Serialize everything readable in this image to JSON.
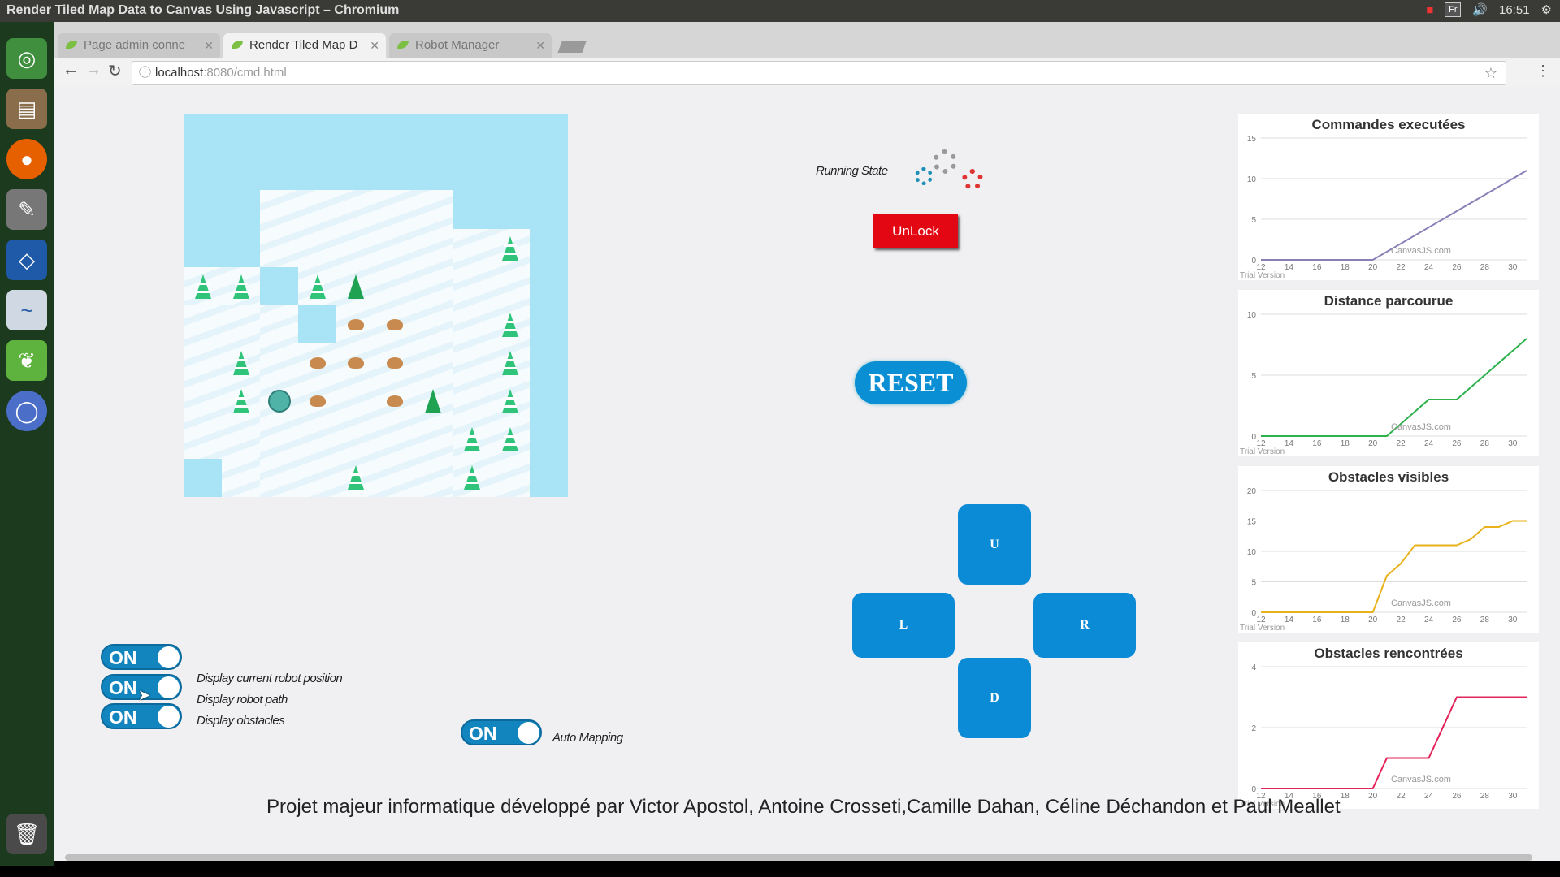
{
  "window": {
    "title": "Render Tiled Map Data to Canvas Using Javascript – Chromium"
  },
  "system_tray": {
    "lang": "Fr",
    "time": "16:51"
  },
  "tabs": [
    {
      "label": "Page admin conne",
      "active": false
    },
    {
      "label": "Render Tiled Map D",
      "active": true
    },
    {
      "label": "Robot Manager",
      "active": false
    }
  ],
  "address_bar": {
    "host": "localhost",
    "rest": ":8080/cmd.html"
  },
  "status": {
    "running_state_label": "Running State"
  },
  "buttons": {
    "unlock": "UnLock",
    "reset": "RESET",
    "up": "U",
    "left": "L",
    "right": "R",
    "down": "D"
  },
  "toggles": [
    {
      "state": "ON",
      "label": ""
    },
    {
      "state": "ON",
      "label": "Display current robot position"
    },
    {
      "state": "ON",
      "label": "Display robot path"
    },
    {
      "state": "ON",
      "label": "Display obstacles"
    },
    {
      "state": "ON",
      "label": "Auto Mapping"
    }
  ],
  "footer_text": "Projet majeur informatique développé par Victor Apostol, Antoine Crosseti,Camille Dahan, Céline Déchandon et Paul Meallet",
  "watermark": "CanvasJS.com",
  "trial": "Trial Version",
  "colors": {
    "accent": "#0b8ad6",
    "unlock": "#e30613",
    "launcher": "#1c3a1e"
  },
  "chart_data": [
    {
      "type": "line",
      "title": "Commandes executées",
      "xlim": [
        12,
        31
      ],
      "ylim": [
        0,
        15
      ],
      "xticks": [
        12,
        14,
        16,
        18,
        20,
        22,
        24,
        26,
        28,
        30
      ],
      "yticks": [
        0,
        5,
        10,
        15
      ],
      "color": "#8b7fb8",
      "x": [
        12,
        20,
        31
      ],
      "y": [
        0,
        0,
        11
      ]
    },
    {
      "type": "line",
      "title": "Distance parcourue",
      "xlim": [
        12,
        31
      ],
      "ylim": [
        0,
        10
      ],
      "xticks": [
        12,
        14,
        16,
        18,
        20,
        22,
        24,
        26,
        28,
        30
      ],
      "yticks": [
        0,
        5,
        10
      ],
      "color": "#2db14c",
      "x": [
        12,
        21,
        24,
        26,
        31
      ],
      "y": [
        0,
        0,
        3,
        3,
        8
      ]
    },
    {
      "type": "line",
      "title": "Obstacles visibles",
      "xlim": [
        12,
        31
      ],
      "ylim": [
        0,
        20
      ],
      "xticks": [
        12,
        14,
        16,
        18,
        20,
        22,
        24,
        26,
        28,
        30
      ],
      "yticks": [
        0,
        5,
        10,
        15,
        20
      ],
      "color": "#e8b21c",
      "x": [
        12,
        20,
        21,
        22,
        23,
        25,
        26,
        27,
        28,
        29,
        30,
        31
      ],
      "y": [
        0,
        0,
        6,
        8,
        11,
        11,
        11,
        12,
        14,
        14,
        15,
        15
      ]
    },
    {
      "type": "line",
      "title": "Obstacles rencontrées",
      "xlim": [
        12,
        31
      ],
      "ylim": [
        0,
        4
      ],
      "xticks": [
        12,
        14,
        16,
        18,
        20,
        22,
        24,
        26,
        28,
        30
      ],
      "yticks": [
        0,
        2,
        4
      ],
      "color": "#e3245a",
      "x": [
        12,
        20,
        21,
        24,
        26,
        31
      ],
      "y": [
        0,
        0,
        1,
        1,
        3,
        3
      ]
    }
  ]
}
